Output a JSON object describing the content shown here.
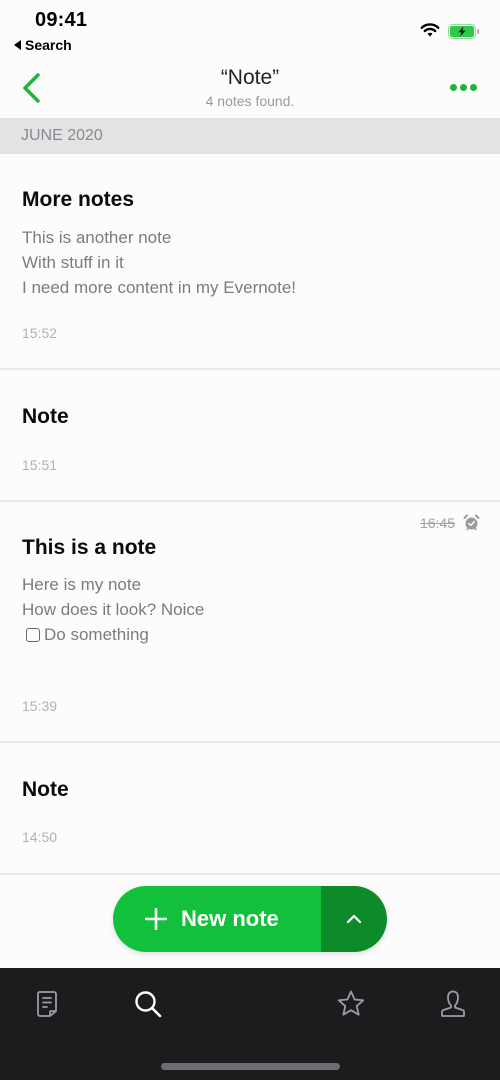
{
  "status_bar": {
    "time": "09:41",
    "back_app": "Search",
    "icons": [
      "wifi-icon",
      "battery-charging-icon"
    ],
    "battery_color": "#30c94a"
  },
  "nav": {
    "title": "“Note”",
    "subtitle": "4 notes found.",
    "back_icon": "chevron-left-icon",
    "more_icon": "more-dots-icon",
    "accent_color": "#1db33c"
  },
  "section": {
    "label": "JUNE 2020"
  },
  "notes": [
    {
      "title": "More notes",
      "lines": [
        "This is another note",
        "With stuff in it",
        "I need more content in my Evernote!"
      ],
      "time": "15:52"
    },
    {
      "title": "Note",
      "lines": [],
      "time": "15:51"
    },
    {
      "title": "This is a note",
      "lines": [
        "Here is my note",
        "How does it look? Noice"
      ],
      "checkbox_item": "Do something",
      "checkbox_checked": false,
      "reminder_time": "16:45",
      "reminder_icon": "alarm-clock-icon",
      "time": "15:39"
    },
    {
      "title": "Note",
      "lines": [],
      "time": "14:50"
    }
  ],
  "fab": {
    "label": "New note",
    "icon": "plus-icon",
    "expand_icon": "chevron-up-icon",
    "color": "#13c03c",
    "secondary_color": "#0d8b2b"
  },
  "tabbar": {
    "items": [
      {
        "name": "notes",
        "icon": "note-document-icon",
        "active": false
      },
      {
        "name": "search",
        "icon": "search-icon",
        "active": true
      },
      {
        "name": "shortcuts",
        "icon": "star-icon",
        "active": false
      },
      {
        "name": "account",
        "icon": "person-icon",
        "active": false
      }
    ]
  }
}
